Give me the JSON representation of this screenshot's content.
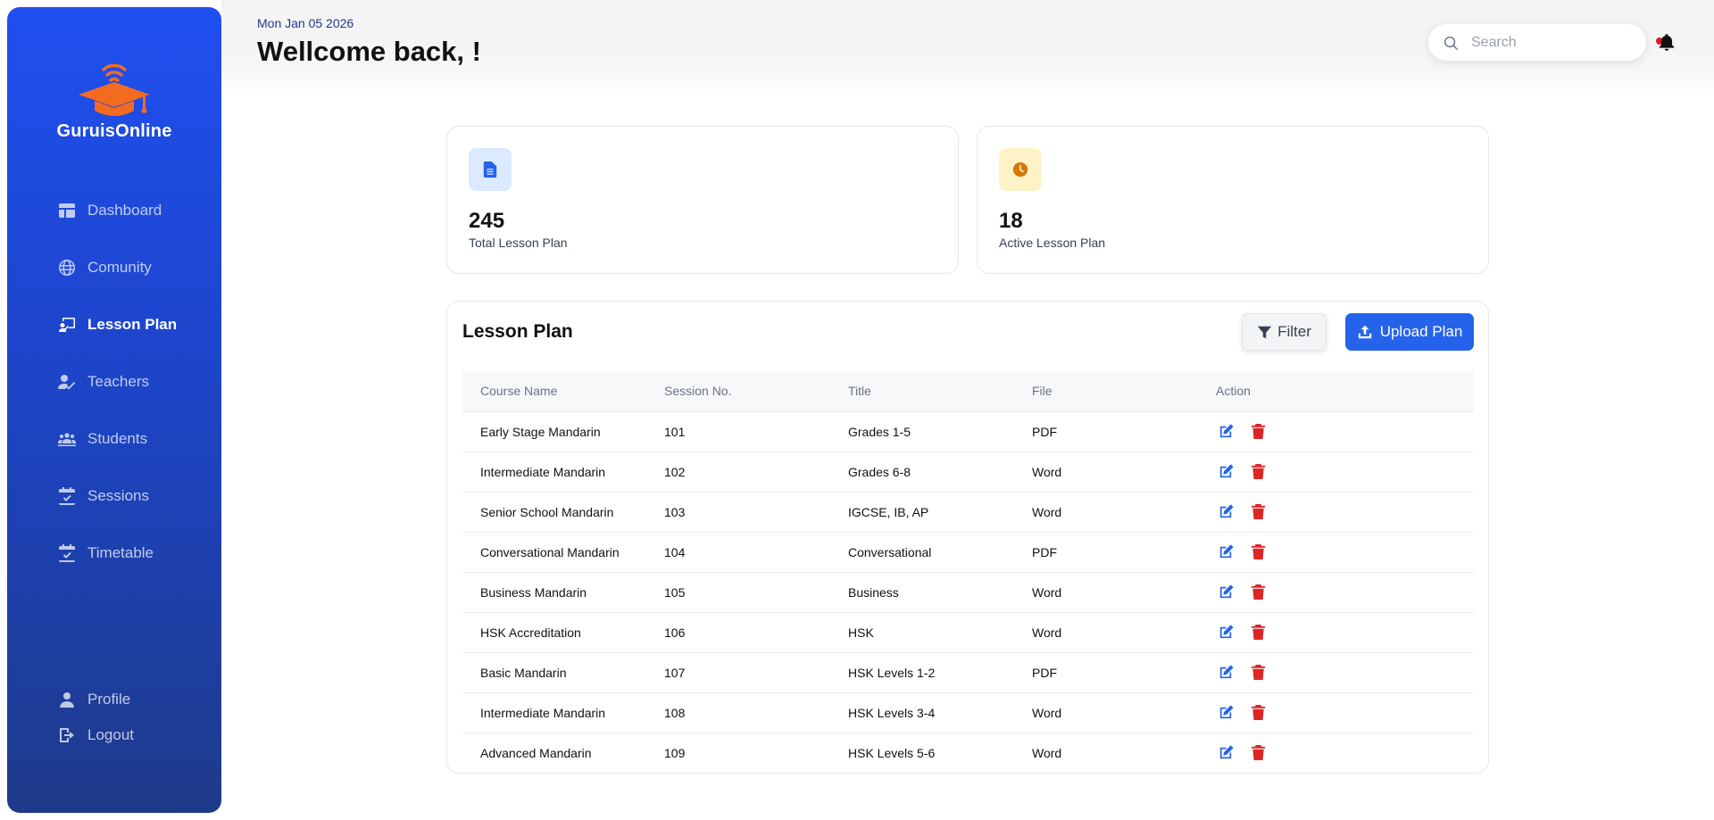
{
  "brand": {
    "name": "GuruisOnline"
  },
  "sidebar": {
    "items": [
      {
        "label": "Dashboard",
        "icon": "dashboard-icon",
        "active": false
      },
      {
        "label": "Comunity",
        "icon": "globe-icon",
        "active": false
      },
      {
        "label": "Lesson Plan",
        "icon": "lesson-plan-icon",
        "active": true
      },
      {
        "label": "Teachers",
        "icon": "teacher-icon",
        "active": false
      },
      {
        "label": "Students",
        "icon": "students-icon",
        "active": false
      },
      {
        "label": "Sessions",
        "icon": "calendar-check-icon",
        "active": false
      },
      {
        "label": "Timetable",
        "icon": "calendar-check-icon",
        "active": false
      }
    ],
    "bottom": [
      {
        "label": "Profile",
        "icon": "user-icon"
      },
      {
        "label": "Logout",
        "icon": "logout-icon"
      }
    ]
  },
  "header": {
    "date": "Mon Jan 05 2026",
    "title": "Wellcome back, !",
    "search_placeholder": "Search"
  },
  "stats": [
    {
      "value": "245",
      "label": "Total Lesson Plan",
      "icon": "document-icon",
      "icon_bg": "#dbeafe",
      "icon_color": "#2563eb"
    },
    {
      "value": "18",
      "label": "Active Lesson Plan",
      "icon": "clock-icon",
      "icon_bg": "#fef3c7",
      "icon_color": "#d97706"
    }
  ],
  "lesson_table": {
    "title": "Lesson Plan",
    "filter_label": "Filter",
    "upload_label": "Upload Plan",
    "columns": [
      "Course Name",
      "Session No.",
      "Title",
      "File",
      "Action"
    ],
    "rows": [
      {
        "course": "Early Stage Mandarin",
        "session": "101",
        "title": "Grades 1-5",
        "file": "PDF"
      },
      {
        "course": "Intermediate Mandarin",
        "session": "102",
        "title": "Grades 6-8",
        "file": "Word"
      },
      {
        "course": "Senior School Mandarin",
        "session": "103",
        "title": "IGCSE, IB, AP",
        "file": "Word"
      },
      {
        "course": "Conversational Mandarin",
        "session": "104",
        "title": "Conversational",
        "file": "PDF"
      },
      {
        "course": "Business Mandarin",
        "session": "105",
        "title": "Business",
        "file": "Word"
      },
      {
        "course": "HSK Accreditation",
        "session": "106",
        "title": "HSK",
        "file": "Word"
      },
      {
        "course": "Basic Mandarin",
        "session": "107",
        "title": "HSK Levels 1-2",
        "file": "PDF"
      },
      {
        "course": "Intermediate Mandarin",
        "session": "108",
        "title": "HSK Levels 3-4",
        "file": "Word"
      },
      {
        "course": "Advanced Mandarin",
        "session": "109",
        "title": "HSK Levels 5-6",
        "file": "Word"
      }
    ]
  },
  "colors": {
    "accent": "#2563eb",
    "delete": "#dc2626",
    "brand_orange": "#f26b21",
    "notification_dot": "#e11d1d"
  }
}
